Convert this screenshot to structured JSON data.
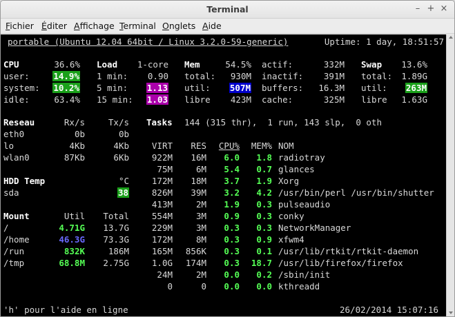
{
  "window": {
    "title": "Terminal"
  },
  "menu": [
    "Fichier",
    "Éditer",
    "Affichage",
    "Terminal",
    "Onglets",
    "Aide"
  ],
  "header": {
    "host": "portable (Ubuntu 12.04 64bit / Linux 3.2.0-59-generic)",
    "uptime": "Uptime: 1 day, 18:51:57"
  },
  "cpu": {
    "label": "CPU",
    "total": "36.6%",
    "user_label": "user:",
    "user": "14.9%",
    "system_label": "system:",
    "system": "10.2%",
    "idle_label": "idle:",
    "idle": "63.4%"
  },
  "load": {
    "label": "Load",
    "cores": "1-core",
    "l1_label": "1 min:",
    "l1": "0.90",
    "l5_label": "5 min:",
    "l5": "1.13",
    "l15_label": "15 min:",
    "l15": "1.03"
  },
  "mem": {
    "label": "Mem",
    "percent": "54.5%",
    "total_label": "total:",
    "total": "930M",
    "util_label": "util:",
    "util": "507M",
    "libre_label": "libre",
    "libre": "423M",
    "actif_label": "actif:",
    "actif": "332M",
    "inactif_label": "inactif:",
    "inactif": "391M",
    "buffers_label": "buffers:",
    "buffers": "16.3M",
    "cache_label": "cache:",
    "cache": "325M"
  },
  "swap": {
    "label": "Swap",
    "percent": "13.6%",
    "total_label": "total:",
    "total": "1.89G",
    "util_label": "util:",
    "util": "263M",
    "libre_label": "libre",
    "libre": "1.63G"
  },
  "network": {
    "label": "Reseau",
    "rx_label": "Rx/s",
    "tx_label": "Tx/s",
    "rows": [
      {
        "name": "eth0",
        "rx": "0b",
        "tx": "0b"
      },
      {
        "name": "lo",
        "rx": "4Kb",
        "tx": "4Kb"
      },
      {
        "name": "wlan0",
        "rx": "87Kb",
        "tx": "6Kb"
      }
    ]
  },
  "hdd": {
    "label": "HDD Temp",
    "unit": "°C",
    "rows": [
      {
        "name": "sda",
        "temp": "38"
      }
    ]
  },
  "mount": {
    "label": "Mount",
    "util_label": "Util",
    "total_label": "Total",
    "rows": [
      {
        "path": "/",
        "util": "4.71G",
        "total": "13.7G"
      },
      {
        "path": "/home",
        "util": "46.3G",
        "total": "73.3G"
      },
      {
        "path": "/run",
        "util": "832K",
        "total": "186M"
      },
      {
        "path": "/tmp",
        "util": "68.8M",
        "total": "2.75G"
      }
    ]
  },
  "tasks": {
    "label": "Tasks",
    "summary": "144 (315 thr),  1 run, 143 slp,  0 oth"
  },
  "processes": {
    "headers": {
      "virt": "VIRT",
      "res": "RES",
      "cpu": "CPU%",
      "mem": "MEM%",
      "name": "NOM"
    },
    "rows": [
      {
        "virt": "922M",
        "res": "16M",
        "cpu": "6.0",
        "mem": "1.8",
        "name": "radiotray"
      },
      {
        "virt": "75M",
        "res": "6M",
        "cpu": "5.4",
        "mem": "0.7",
        "name": "glances"
      },
      {
        "virt": "172M",
        "res": "18M",
        "cpu": "3.7",
        "mem": "1.9",
        "name": "Xorg"
      },
      {
        "virt": "826M",
        "res": "39M",
        "cpu": "3.2",
        "mem": "4.2",
        "name": "/usr/bin/perl /usr/bin/shutter"
      },
      {
        "virt": "413M",
        "res": "2M",
        "cpu": "1.9",
        "mem": "0.3",
        "name": "pulseaudio"
      },
      {
        "virt": "554M",
        "res": "3M",
        "cpu": "0.9",
        "mem": "0.3",
        "name": "conky"
      },
      {
        "virt": "229M",
        "res": "3M",
        "cpu": "0.3",
        "mem": "0.3",
        "name": "NetworkManager"
      },
      {
        "virt": "172M",
        "res": "8M",
        "cpu": "0.3",
        "mem": "0.9",
        "name": "xfwm4"
      },
      {
        "virt": "165M",
        "res": "856K",
        "cpu": "0.3",
        "mem": "0.1",
        "name": "/usr/lib/rtkit/rtkit-daemon"
      },
      {
        "virt": "1.0G",
        "res": "174M",
        "cpu": "0.3",
        "mem": "18.7",
        "name": "/usr/lib/firefox/firefox"
      },
      {
        "virt": "24M",
        "res": "2M",
        "cpu": "0.0",
        "mem": "0.2",
        "name": "/sbin/init"
      },
      {
        "virt": "0",
        "res": "0",
        "cpu": "0.0",
        "mem": "0.0",
        "name": "kthreadd"
      }
    ]
  },
  "footer": {
    "help": "'h' pour l'aide en ligne",
    "datetime": "26/02/2014 15:07:16"
  },
  "colors": {
    "highlight_green": "#1aa01a",
    "highlight_magenta": "#aa00aa",
    "highlight_blue": "#0000cc",
    "value_green": "#55ff55",
    "value_blue": "#6a6aff"
  },
  "icons": {
    "minimize": "minimize-icon",
    "maximize": "maximize-icon",
    "close": "close-icon"
  }
}
